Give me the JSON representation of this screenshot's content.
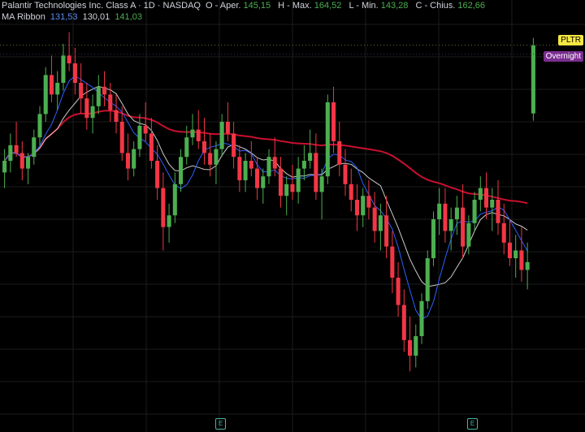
{
  "header": {
    "symbol_title": "Palantir Technologies Inc. Class A · 1D · NASDAQ",
    "ohlc": [
      {
        "label": "O - Aper.",
        "value": "145,15"
      },
      {
        "label": "H - Max.",
        "value": "164,52"
      },
      {
        "label": "L - Min.",
        "value": "143,28"
      },
      {
        "label": "C - Chius.",
        "value": "162,66"
      }
    ],
    "indicator_name": "MA Ribbon",
    "indicator_values": [
      {
        "value": "131,53",
        "color": "#5b8def"
      },
      {
        "value": "130,01",
        "color": "#d1d4dc"
      },
      {
        "value": "141,03",
        "color": "#4caf50"
      }
    ]
  },
  "tags": {
    "symbol": "PLTR",
    "session": "Overnight"
  },
  "earnings_markers": [
    {
      "label": "E"
    },
    {
      "label": "E"
    }
  ],
  "colors": {
    "up": "#4caf50",
    "down": "#f23645",
    "ma_long": "#c8102e",
    "ma_short": "#2962ff",
    "ma_mid": "#c9c9c9",
    "grid": "#1c1c1c"
  },
  "chart_data": {
    "type": "candlestick",
    "ylim": [
      68,
      168
    ],
    "grid": true,
    "series": [
      {
        "values": [
          [
            130,
            136,
            126,
            133
          ],
          [
            133,
            140,
            130,
            137
          ],
          [
            137,
            143,
            134,
            135
          ],
          [
            135,
            138,
            128,
            131
          ],
          [
            131,
            135,
            127,
            134
          ],
          [
            134,
            141,
            132,
            139
          ],
          [
            139,
            147,
            137,
            145
          ],
          [
            145,
            157,
            143,
            155
          ],
          [
            155,
            160,
            148,
            150
          ],
          [
            150,
            156,
            146,
            153
          ],
          [
            153,
            163,
            151,
            160
          ],
          [
            160,
            166,
            156,
            158
          ],
          [
            158,
            162,
            150,
            153
          ],
          [
            153,
            158,
            145,
            149
          ],
          [
            149,
            153,
            141,
            144
          ],
          [
            144,
            150,
            140,
            147
          ],
          [
            147,
            155,
            145,
            152
          ],
          [
            152,
            156,
            147,
            150
          ],
          [
            150,
            153,
            143,
            146
          ],
          [
            146,
            150,
            140,
            143
          ],
          [
            143,
            147,
            133,
            135
          ],
          [
            135,
            140,
            128,
            131
          ],
          [
            131,
            138,
            129,
            136
          ],
          [
            136,
            145,
            134,
            142
          ],
          [
            142,
            148,
            138,
            140
          ],
          [
            140,
            144,
            131,
            133
          ],
          [
            133,
            137,
            123,
            126
          ],
          [
            126,
            130,
            110,
            116
          ],
          [
            116,
            122,
            112,
            119
          ],
          [
            119,
            130,
            117,
            127
          ],
          [
            127,
            136,
            125,
            134
          ],
          [
            134,
            142,
            132,
            139
          ],
          [
            139,
            145,
            137,
            141
          ],
          [
            141,
            146,
            136,
            138
          ],
          [
            138,
            144,
            132,
            135
          ],
          [
            135,
            140,
            129,
            132
          ],
          [
            132,
            138,
            127,
            136
          ],
          [
            136,
            145,
            134,
            143
          ],
          [
            143,
            148,
            138,
            140
          ],
          [
            140,
            143,
            131,
            134
          ],
          [
            134,
            137,
            125,
            128
          ],
          [
            128,
            135,
            125,
            133
          ],
          [
            133,
            138,
            129,
            131
          ],
          [
            131,
            134,
            123,
            126
          ],
          [
            126,
            131,
            122,
            129
          ],
          [
            129,
            136,
            127,
            134
          ],
          [
            134,
            139,
            129,
            131
          ],
          [
            131,
            134,
            121,
            124
          ],
          [
            124,
            129,
            119,
            127
          ],
          [
            127,
            132,
            123,
            125
          ],
          [
            125,
            134,
            122,
            131
          ],
          [
            131,
            137,
            128,
            133
          ],
          [
            133,
            141,
            131,
            135
          ],
          [
            135,
            140,
            123,
            125
          ],
          [
            125,
            131,
            118,
            129
          ],
          [
            129,
            150,
            127,
            148
          ],
          [
            148,
            152,
            135,
            138
          ],
          [
            138,
            143,
            129,
            132
          ],
          [
            132,
            136,
            124,
            127
          ],
          [
            127,
            131,
            120,
            123
          ],
          [
            123,
            127,
            115,
            119
          ],
          [
            119,
            126,
            116,
            124
          ],
          [
            124,
            128,
            118,
            121
          ],
          [
            121,
            125,
            112,
            115
          ],
          [
            115,
            122,
            110,
            119
          ],
          [
            119,
            124,
            108,
            111
          ],
          [
            111,
            115,
            99,
            103
          ],
          [
            103,
            107,
            93,
            96
          ],
          [
            96,
            100,
            84,
            87
          ],
          [
            87,
            93,
            79,
            83
          ],
          [
            83,
            91,
            80,
            88
          ],
          [
            88,
            99,
            86,
            97
          ],
          [
            97,
            110,
            95,
            108
          ],
          [
            108,
            120,
            106,
            118
          ],
          [
            118,
            126,
            114,
            122
          ],
          [
            122,
            126,
            112,
            115
          ],
          [
            115,
            121,
            110,
            118
          ],
          [
            118,
            124,
            114,
            121
          ],
          [
            121,
            127,
            108,
            111
          ],
          [
            111,
            119,
            109,
            117
          ],
          [
            117,
            125,
            115,
            123
          ],
          [
            123,
            129,
            120,
            126
          ],
          [
            126,
            130,
            118,
            121
          ],
          [
            121,
            126,
            115,
            123
          ],
          [
            123,
            128,
            114,
            117
          ],
          [
            117,
            122,
            109,
            112
          ],
          [
            112,
            118,
            106,
            108
          ],
          [
            108,
            114,
            103,
            110
          ],
          [
            110,
            116,
            102,
            105
          ],
          [
            105,
            112,
            100,
            107
          ],
          [
            145.15,
            164.52,
            143.28,
            162.66
          ]
        ]
      }
    ]
  }
}
